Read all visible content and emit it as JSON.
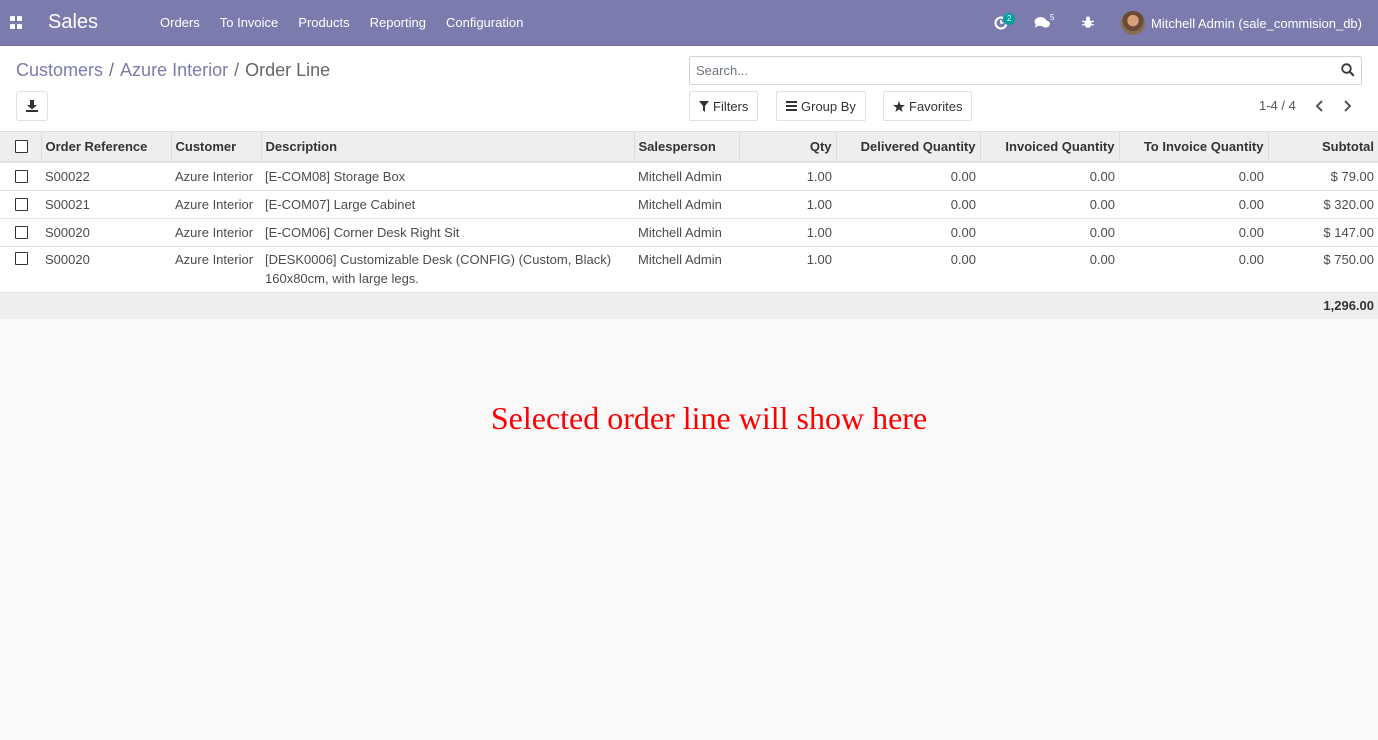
{
  "navbar": {
    "app_name": "Sales",
    "menu": [
      "Orders",
      "To Invoice",
      "Products",
      "Reporting",
      "Configuration"
    ],
    "activity_count": "2",
    "message_count": "5",
    "user_name": "Mitchell Admin (sale_commision_db)",
    "icons": [
      "apps-icon",
      "activity-clock-icon",
      "chat-bubbles-icon",
      "bug-icon"
    ]
  },
  "breadcrumb": {
    "items": [
      "Customers",
      "Azure Interior"
    ],
    "current": "Order Line",
    "separator": "/"
  },
  "search": {
    "placeholder": "Search..."
  },
  "filters": {
    "filters_label": "Filters",
    "group_by_label": "Group By",
    "favorites_label": "Favorites"
  },
  "pager": {
    "text": "1-4 / 4"
  },
  "table": {
    "columns": [
      "Order Reference",
      "Customer",
      "Description",
      "Salesperson",
      "Qty",
      "Delivered Quantity",
      "Invoiced Quantity",
      "To Invoice Quantity",
      "Subtotal"
    ],
    "rows": [
      {
        "order_ref": "S00022",
        "customer": "Azure Interior",
        "description": "[E-COM08] Storage Box",
        "salesperson": "Mitchell Admin",
        "qty": "1.00",
        "delivered": "0.00",
        "invoiced": "0.00",
        "to_invoice": "0.00",
        "subtotal": "$ 79.00"
      },
      {
        "order_ref": "S00021",
        "customer": "Azure Interior",
        "description": "[E-COM07] Large Cabinet",
        "salesperson": "Mitchell Admin",
        "qty": "1.00",
        "delivered": "0.00",
        "invoiced": "0.00",
        "to_invoice": "0.00",
        "subtotal": "$ 320.00"
      },
      {
        "order_ref": "S00020",
        "customer": "Azure Interior",
        "description": "[E-COM06] Corner Desk Right Sit",
        "salesperson": "Mitchell Admin",
        "qty": "1.00",
        "delivered": "0.00",
        "invoiced": "0.00",
        "to_invoice": "0.00",
        "subtotal": "$ 147.00"
      },
      {
        "order_ref": "S00020",
        "customer": "Azure Interior",
        "description": "[DESK0006] Customizable Desk (CONFIG) (Custom, Black) 160x80cm, with large legs.",
        "salesperson": "Mitchell Admin",
        "qty": "1.00",
        "delivered": "0.00",
        "invoiced": "0.00",
        "to_invoice": "0.00",
        "subtotal": "$ 750.00"
      }
    ],
    "total": "1,296.00"
  },
  "annotation": "Selected order line will show here",
  "colors": {
    "navbar_bg": "#7c7bad",
    "link": "#7c7bad",
    "annotation": "#ff0000",
    "badge_green": "#00a09d"
  }
}
